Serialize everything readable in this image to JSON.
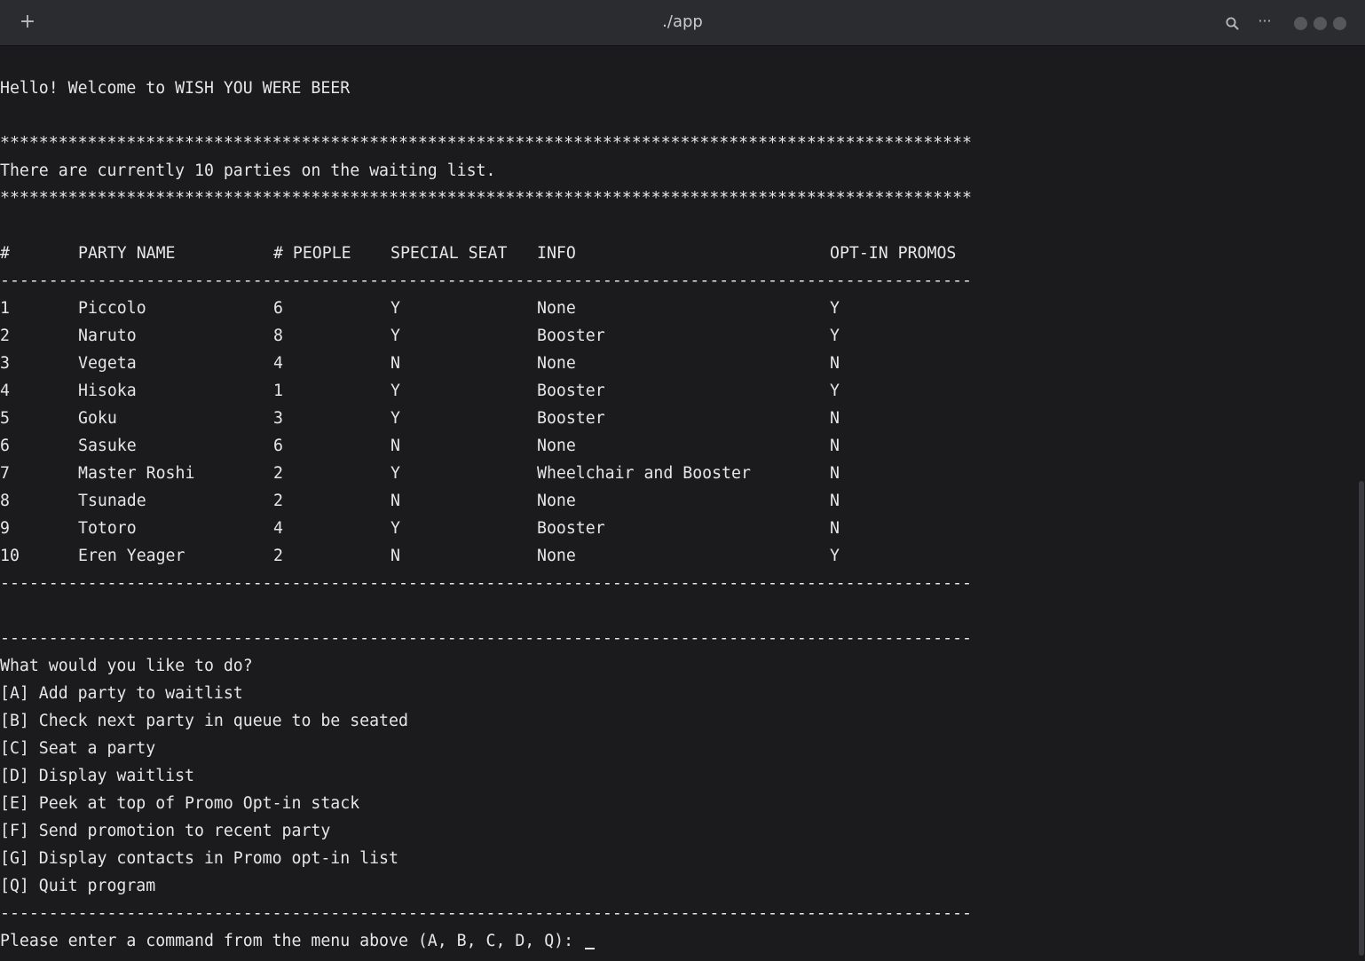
{
  "window": {
    "title": "./app",
    "new_tab_label": "+",
    "more_label": "···"
  },
  "terminal": {
    "greeting": "Hello! Welcome to WISH YOU WERE BEER",
    "stars": "****************************************************************************************************",
    "dashes": "----------------------------------------------------------------------------------------------------",
    "status": "There are currently 10 parties on the waiting list.",
    "table": {
      "headers": [
        "#",
        "PARTY NAME",
        "# PEOPLE",
        "SPECIAL SEAT",
        "INFO",
        "OPT-IN PROMOS"
      ],
      "rows": [
        [
          "1",
          "Piccolo",
          "6",
          "Y",
          "None",
          "Y"
        ],
        [
          "2",
          "Naruto",
          "8",
          "Y",
          "Booster",
          "Y"
        ],
        [
          "3",
          "Vegeta",
          "4",
          "N",
          "None",
          "N"
        ],
        [
          "4",
          "Hisoka",
          "1",
          "Y",
          "Booster",
          "Y"
        ],
        [
          "5",
          "Goku",
          "3",
          "Y",
          "Booster",
          "N"
        ],
        [
          "6",
          "Sasuke",
          "6",
          "N",
          "None",
          "N"
        ],
        [
          "7",
          "Master Roshi",
          "2",
          "Y",
          "Wheelchair and Booster",
          "N"
        ],
        [
          "8",
          "Tsunade",
          "2",
          "N",
          "None",
          "N"
        ],
        [
          "9",
          "Totoro",
          "4",
          "Y",
          "Booster",
          "N"
        ],
        [
          "10",
          "Eren Yeager",
          "2",
          "N",
          "None",
          "Y"
        ]
      ]
    },
    "menu": {
      "prompt": "What would you like to do?",
      "items": [
        "[A] Add party to waitlist",
        "[B] Check next party in queue to be seated",
        "[C] Seat a party",
        "[D] Display waitlist",
        "[E] Peek at top of Promo Opt-in stack",
        "[F] Send promotion to recent party",
        "[G] Display contacts in Promo opt-in list",
        "[Q] Quit program"
      ]
    },
    "input_prompt": "Please enter a command from the menu above (A, B, C, D, Q): "
  }
}
